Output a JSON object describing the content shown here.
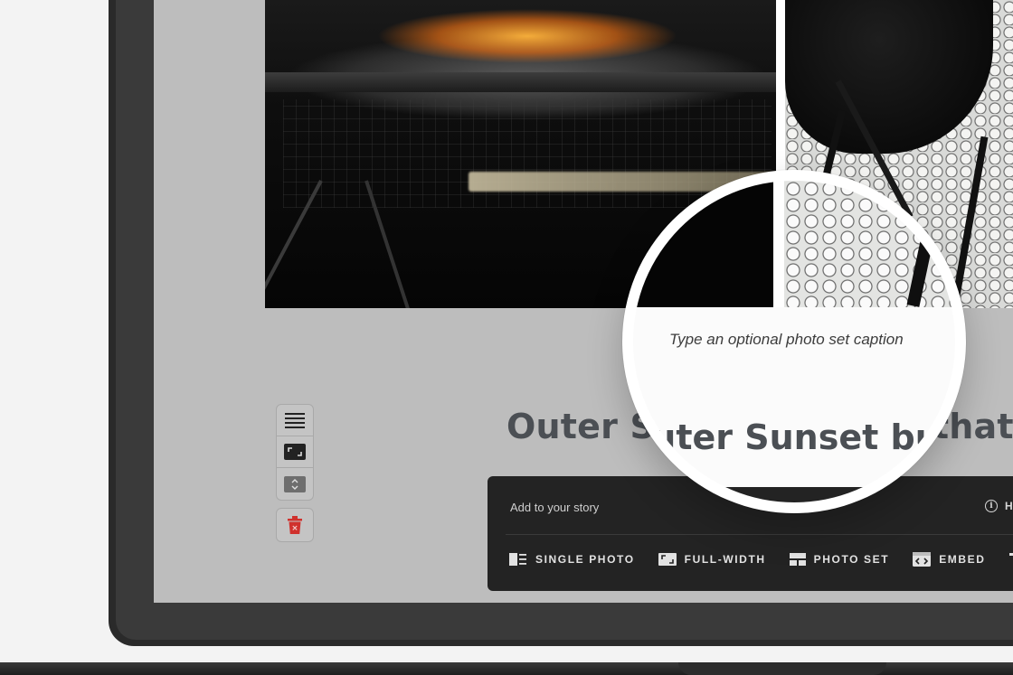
{
  "canvas_background": "#f3f3f3",
  "editor": {
    "headline": "Outer Sunset but not that far.",
    "headline_magnified": "Outer Sunset but not that far.",
    "caption_placeholder": "Type an optional photo set caption"
  },
  "tools": [
    {
      "name": "align-text",
      "icon": "align-lines-icon"
    },
    {
      "name": "full-width",
      "icon": "expand-icon"
    },
    {
      "name": "reorder",
      "icon": "up-down-chevron-icon"
    },
    {
      "name": "delete",
      "icon": "trash-icon",
      "color": "#d0312d"
    }
  ],
  "story_bar": {
    "title": "Add to your story",
    "help_label": "H",
    "actions": [
      {
        "label": "SINGLE PHOTO",
        "icon": "single-photo-icon"
      },
      {
        "label": "FULL-WIDTH",
        "icon": "full-width-icon"
      },
      {
        "label": "PHOTO SET",
        "icon": "photo-set-icon"
      },
      {
        "label": "EMBED",
        "icon": "embed-icon"
      },
      {
        "label": "",
        "icon": "text-icon"
      }
    ],
    "background": "#232323"
  },
  "colors": {
    "screen_bg": "#bdbdbd",
    "headline": "#4b4f54",
    "delete": "#d0312d"
  }
}
